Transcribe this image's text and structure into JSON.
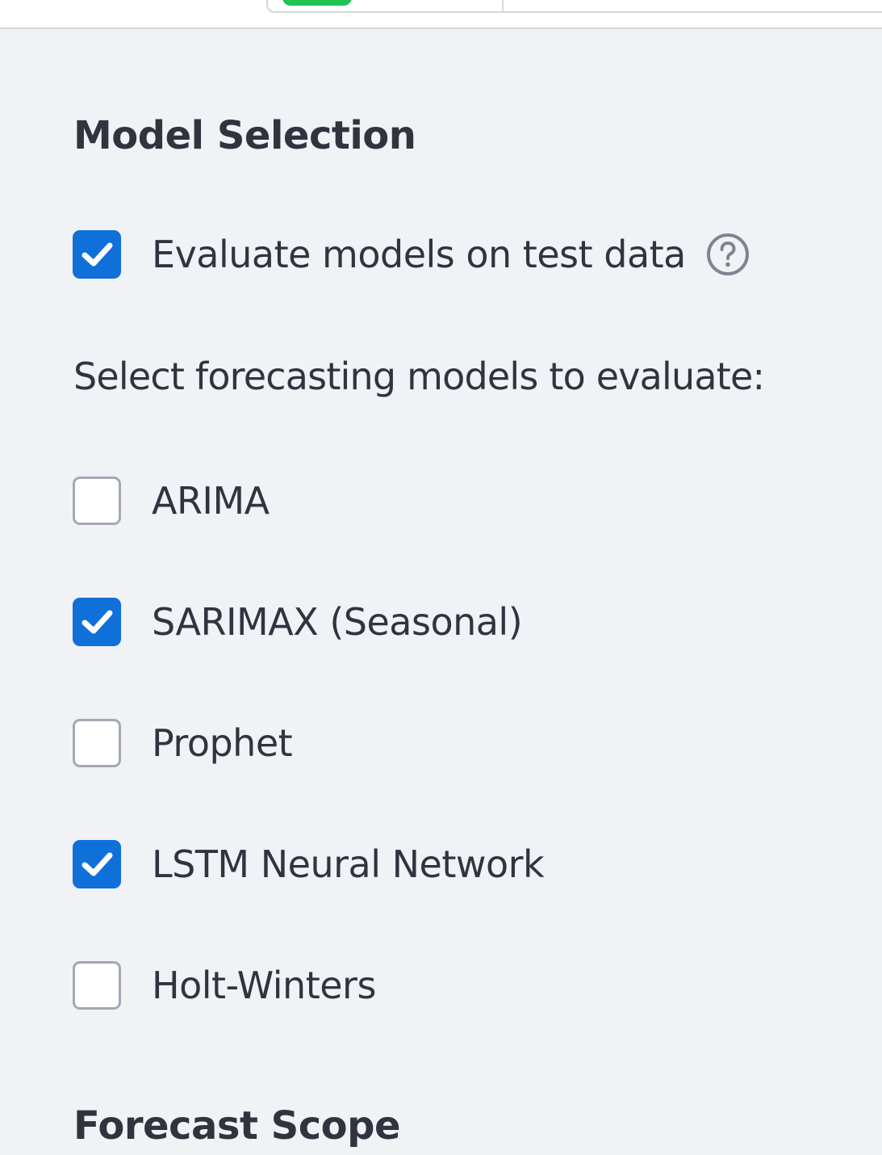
{
  "colors": {
    "background": "#f0f2f6",
    "text": "#31333f",
    "checkbox_checked": "#0f70d9",
    "checkbox_border": "#a3a8b4",
    "top_pill": "#21c354"
  },
  "model_selection": {
    "title": "Model Selection",
    "evaluate_option": {
      "label": "Evaluate models on test data",
      "checked": true,
      "help_icon": "question-circle-icon"
    },
    "prompt": "Select forecasting models to evaluate:",
    "models": [
      {
        "label": "ARIMA",
        "checked": false
      },
      {
        "label": "SARIMAX (Seasonal)",
        "checked": true
      },
      {
        "label": "Prophet",
        "checked": false
      },
      {
        "label": "LSTM Neural Network",
        "checked": true
      },
      {
        "label": "Holt-Winters",
        "checked": false
      }
    ]
  },
  "forecast_scope": {
    "title": "Forecast Scope"
  }
}
